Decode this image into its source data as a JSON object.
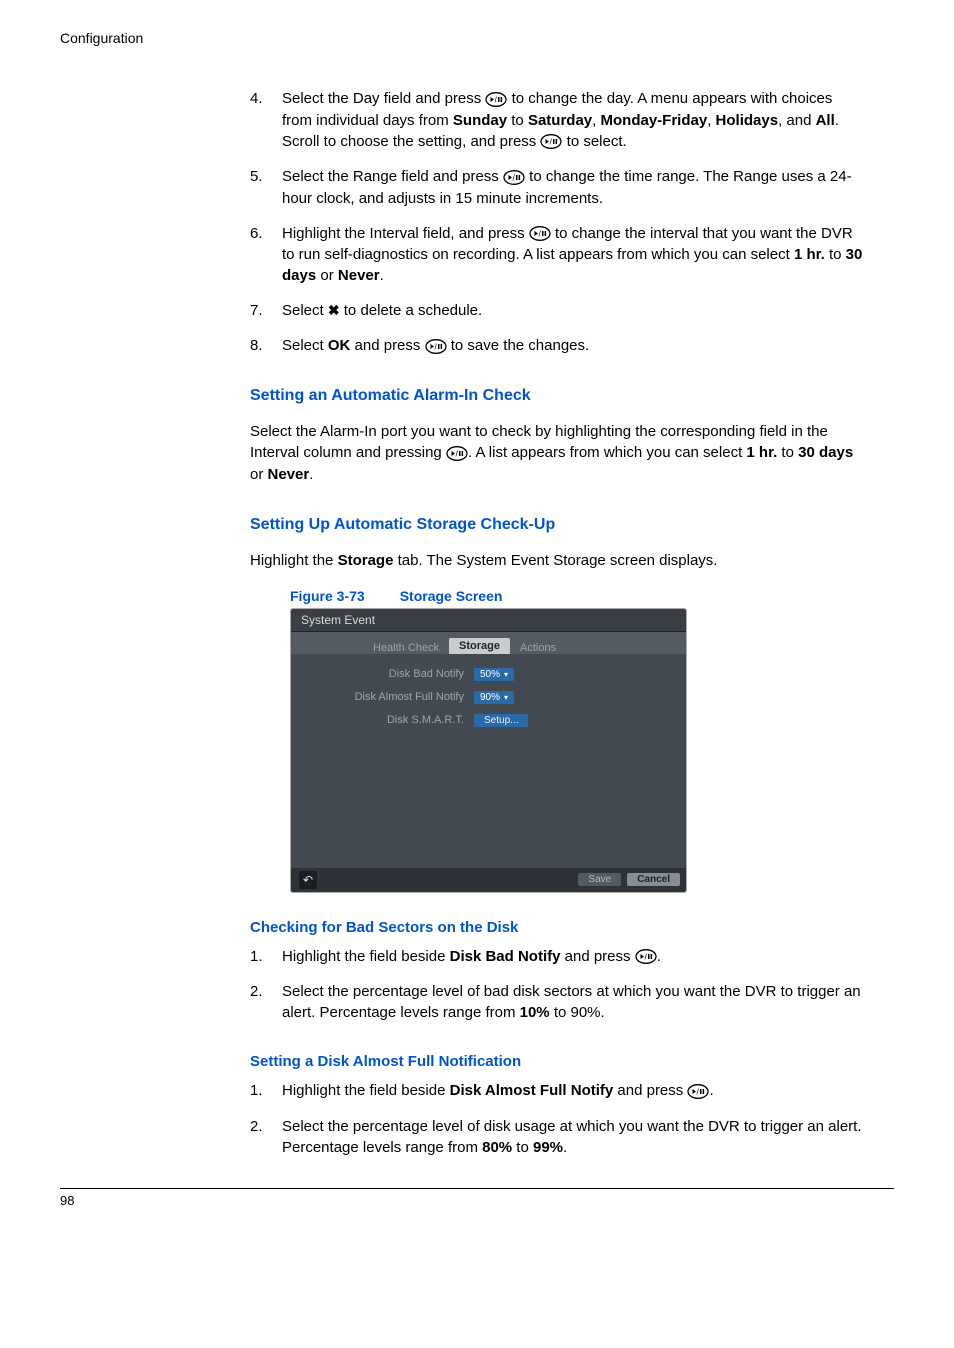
{
  "header": {
    "section": "Configuration"
  },
  "steps1": [
    {
      "num": "4.",
      "html_parts": [
        "Select the Day field and press ",
        "[ICON]",
        " to change the day. A menu appears with choices from individual days from ",
        "[B]Sunday[/B]",
        " to ",
        "[B]Saturday[/B]",
        ", ",
        "[B]Monday-Friday[/B]",
        ", ",
        "[B]Holidays[/B]",
        ", and ",
        "[B]All[/B]",
        ". Scroll to choose the setting, and press ",
        "[ICON]",
        " to select."
      ]
    },
    {
      "num": "5.",
      "html_parts": [
        "Select the Range field and press ",
        "[ICON]",
        " to change the time range. The Range uses a 24-hour clock, and adjusts in 15 minute increments."
      ]
    },
    {
      "num": "6.",
      "html_parts": [
        "Highlight the Interval field, and press ",
        "[ICON]",
        " to change the interval that you want the DVR to run self-diagnostics on recording. A list appears from which you can select ",
        "[B]1 hr.[/B]",
        " to ",
        "[B]30 days[/B]",
        " or ",
        "[B]Never[/B]",
        "."
      ]
    },
    {
      "num": "7.",
      "html_parts": [
        "Select ",
        "[X]",
        " to delete a schedule."
      ]
    },
    {
      "num": "8.",
      "html_parts": [
        "Select ",
        "[B]OK[/B]",
        " and press ",
        "[ICON]",
        " to save the changes."
      ]
    }
  ],
  "h_alarm": "Setting an Automatic Alarm-In Check",
  "p_alarm_parts": [
    "Select the Alarm-In port you want to check by highlighting the corresponding field in the Interval column and pressing ",
    "[ICON]",
    ". A list appears from which you can select ",
    "[B]1 hr.[/B]",
    " to ",
    "[B]30 days[/B]",
    " or ",
    "[B]Never[/B]",
    "."
  ],
  "h_storage": "Setting Up Automatic Storage Check-Up",
  "p_storage_parts": [
    "Highlight the ",
    "[B]Storage[/B]",
    " tab. The System Event Storage screen displays."
  ],
  "fig": {
    "num": "Figure 3-73",
    "title": "Storage Screen"
  },
  "screen": {
    "title": "System Event",
    "tabs": {
      "left": "Health Check",
      "active": "Storage",
      "right": "Actions"
    },
    "rows": {
      "bad_label": "Disk Bad Notify",
      "bad_value": "50%",
      "full_label": "Disk Almost Full Notify",
      "full_value": "90%",
      "smart_label": "Disk S.M.A.R.T.",
      "smart_btn": "Setup..."
    },
    "save": "Save",
    "cancel": "Cancel"
  },
  "h_badsect": "Checking for Bad Sectors on the Disk",
  "steps_bad": [
    {
      "num": "1.",
      "html_parts": [
        "Highlight the field beside ",
        "[B]Disk Bad Notify[/B]",
        " and press ",
        "[ICON]",
        "."
      ]
    },
    {
      "num": "2.",
      "html_parts": [
        "Select the percentage level of bad disk sectors at which you want the DVR to trigger an alert. Percentage levels range from ",
        "[B]10%[/B]",
        " to 90%."
      ]
    }
  ],
  "h_diskfull": "Setting a Disk Almost Full Notification",
  "steps_full": [
    {
      "num": "1.",
      "html_parts": [
        "Highlight the field beside ",
        "[B]Disk Almost Full Notify[/B]",
        " and press ",
        "[ICON]",
        "."
      ]
    },
    {
      "num": "2.",
      "html_parts": [
        "Select the percentage level of disk usage at which you want the DVR to trigger an alert. Percentage levels range from ",
        "[B]80%[/B]",
        " to ",
        "[B]99%[/B]",
        "."
      ]
    }
  ],
  "page_number": "98"
}
